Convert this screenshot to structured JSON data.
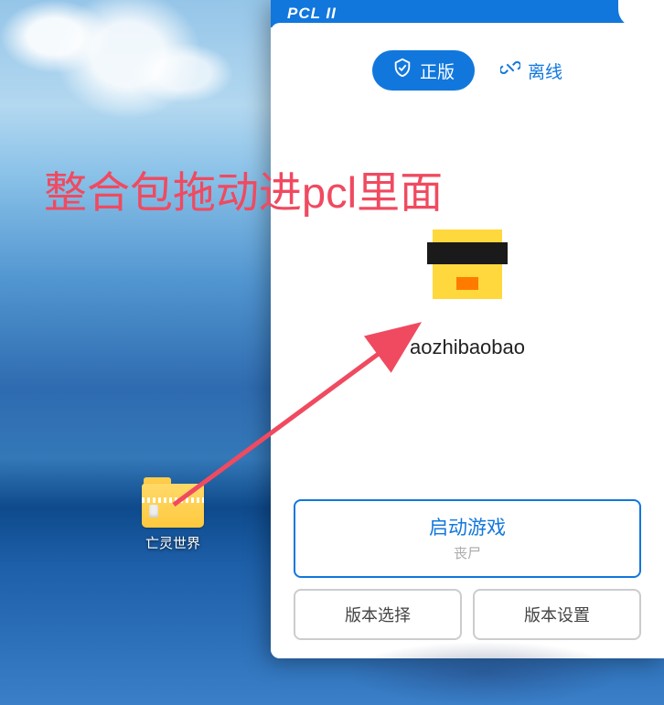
{
  "desktop": {
    "icon_label": "亡灵世界"
  },
  "pcl": {
    "title": "PCL II",
    "tabs": {
      "genuine": "正版",
      "offline": "离线"
    },
    "username": "aozhibaobao",
    "launch": {
      "label": "启动游戏",
      "sub": "丧尸"
    },
    "version_select": "版本选择",
    "version_settings": "版本设置"
  },
  "annotation": {
    "text": "整合包拖动进pcl里面"
  }
}
